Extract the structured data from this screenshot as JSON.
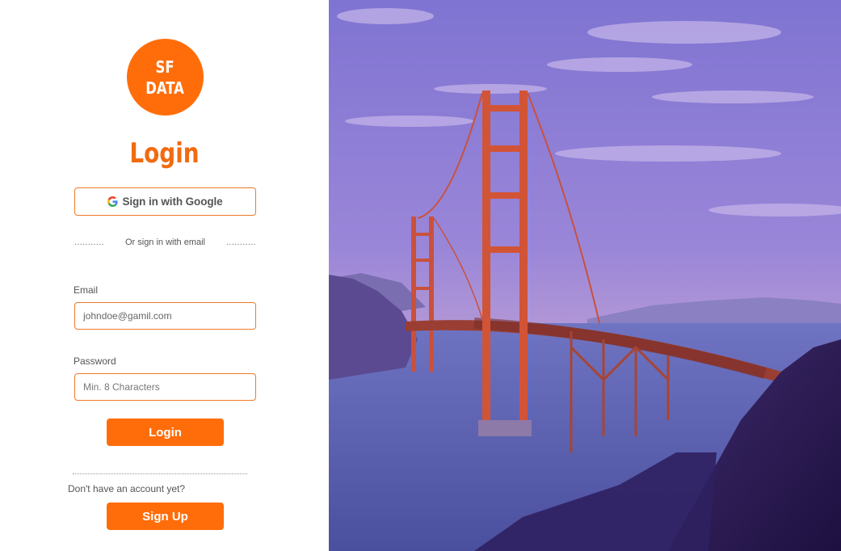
{
  "logo": {
    "line1": "SF",
    "line2": "DATA"
  },
  "title": "Login",
  "google_button": {
    "label": "Sign in with Google"
  },
  "divider": {
    "left_dots": "...........",
    "text": "Or sign in with email",
    "right_dots": "..........."
  },
  "email": {
    "label": "Email",
    "value": "johndoe@gamil.com"
  },
  "password": {
    "label": "Password",
    "placeholder": "Min. 8 Characters"
  },
  "login_button": {
    "label": "Login"
  },
  "signup_prompt": "Don't have an account yet?",
  "signup_button": {
    "label": "Sign Up"
  },
  "colors": {
    "accent": "#ff6d0a",
    "border": "#f07a2a",
    "sky": "#8a7fd6"
  },
  "icons": [
    "google-icon"
  ]
}
